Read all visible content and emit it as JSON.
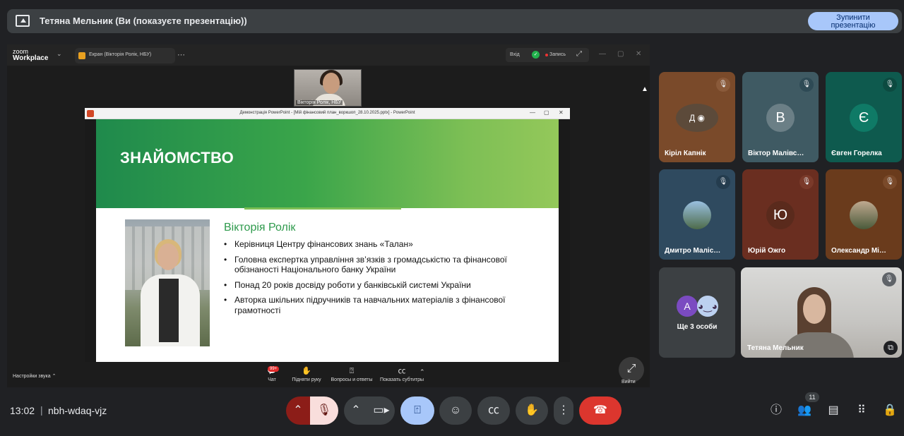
{
  "banner": {
    "title": "Тетяна Мельник (Ви (показуєте презентацію))",
    "stop_line1": "Зупинити",
    "stop_line2": "презентацію"
  },
  "zoom": {
    "logo_line1": "zoom",
    "logo_line2": "Workplace",
    "tab_label": "Екран (Вікторія Ролік, НБУ)",
    "enter_label": "Вхід",
    "record_label": "Запись",
    "presenter_thumb_name": "Вікторія Ролік, НБУ",
    "audio_settings": "Настройки звука",
    "chat_badge": "99+",
    "chat_label": "Чат",
    "raise_hand_label": "Підняти руку",
    "qa_label": "Вопросы и ответы",
    "subtitles_label": "Показать субтитры",
    "exit_label": "Вийти"
  },
  "powerpoint": {
    "window_title": "Демонстрація PowerPoint - [Мій фінансовий план_воркшоп_28.10.2025.pptx] - PowerPoint"
  },
  "slide": {
    "title": "ЗНАЙОМСТВО",
    "person_name": "Вікторія Ролік",
    "bullets": [
      "Керівниця Центру фінансових знань «Талан»",
      "Головна експертка управління зв’язків з громадськістю та фінансової обізнаності Національного банку України",
      "Понад 20 років досвіду роботи у банківській системі України",
      "Авторка шкільних підручників та навчальних матеріалів з фінансової грамотності"
    ]
  },
  "participants": [
    {
      "name": "Кіріл Капнік",
      "avatar": "",
      "color": "#7a4a2a"
    },
    {
      "name": "Віктор Малівс…",
      "avatar": "В",
      "color": "#3f5a63"
    },
    {
      "name": "Євген Горелка",
      "avatar": "Є",
      "color": "#0e5a4e"
    },
    {
      "name": "Дмитро Маліс…",
      "avatar": "",
      "color": "#2f4a5f"
    },
    {
      "name": "Юрій Ожго",
      "avatar": "Ю",
      "color": "#6a2e20"
    },
    {
      "name": "Олександр Мі…",
      "avatar": "",
      "color": "#6a3b1c"
    }
  ],
  "others": {
    "avatar1": "A",
    "label": "Ще 3 особи"
  },
  "self": {
    "name": "Тетяна Мельник"
  },
  "meeting": {
    "time": "13:02",
    "separator": "|",
    "code": "nbh-wdaq-vjz",
    "participant_count": "11"
  }
}
